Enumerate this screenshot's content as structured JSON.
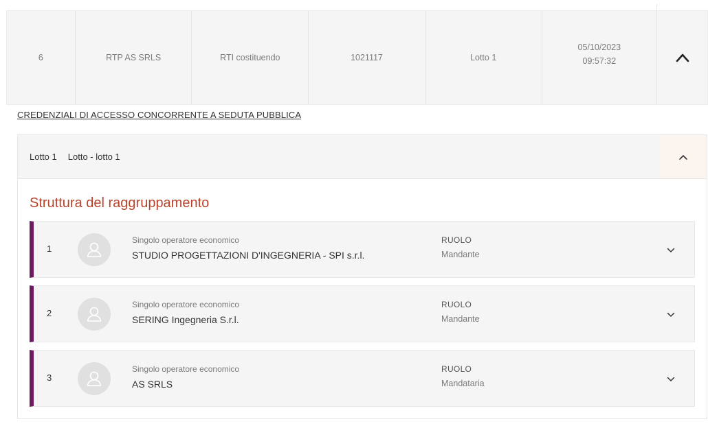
{
  "summary": {
    "index": "6",
    "name": "RTP AS SRLS",
    "type": "RTI costituendo",
    "code": "1021117",
    "lot": "Lotto 1",
    "date": "05/10/2023",
    "time": "09:57:32",
    "toggle_icon": "chevron-up-icon"
  },
  "credentials_link": "CREDENZIALI DI ACCESSO CONCORRENTE A SEDUTA PUBBLICA",
  "lot_panel": {
    "lot_number": "Lotto 1",
    "lot_description": "Lotto - lotto 1",
    "toggle_icon": "chevron-up-icon"
  },
  "section_title": "Struttura del raggruppamento",
  "members": [
    {
      "index": "1",
      "type": "Singolo operatore economico",
      "name": "STUDIO PROGETTAZIONI D'INGEGNERIA - SPI s.r.l.",
      "role_label": "RUOLO",
      "role": "Mandante"
    },
    {
      "index": "2",
      "type": "Singolo operatore economico",
      "name": "SERING Ingegneria S.r.l.",
      "role_label": "RUOLO",
      "role": "Mandante"
    },
    {
      "index": "3",
      "type": "Singolo operatore economico",
      "name": "AS SRLS",
      "role_label": "RUOLO",
      "role": "Mandataria"
    }
  ],
  "colors": {
    "accent_title": "#b8442b",
    "member_stripe": "#6d1b5e",
    "row_background": "#f5f5f5"
  }
}
